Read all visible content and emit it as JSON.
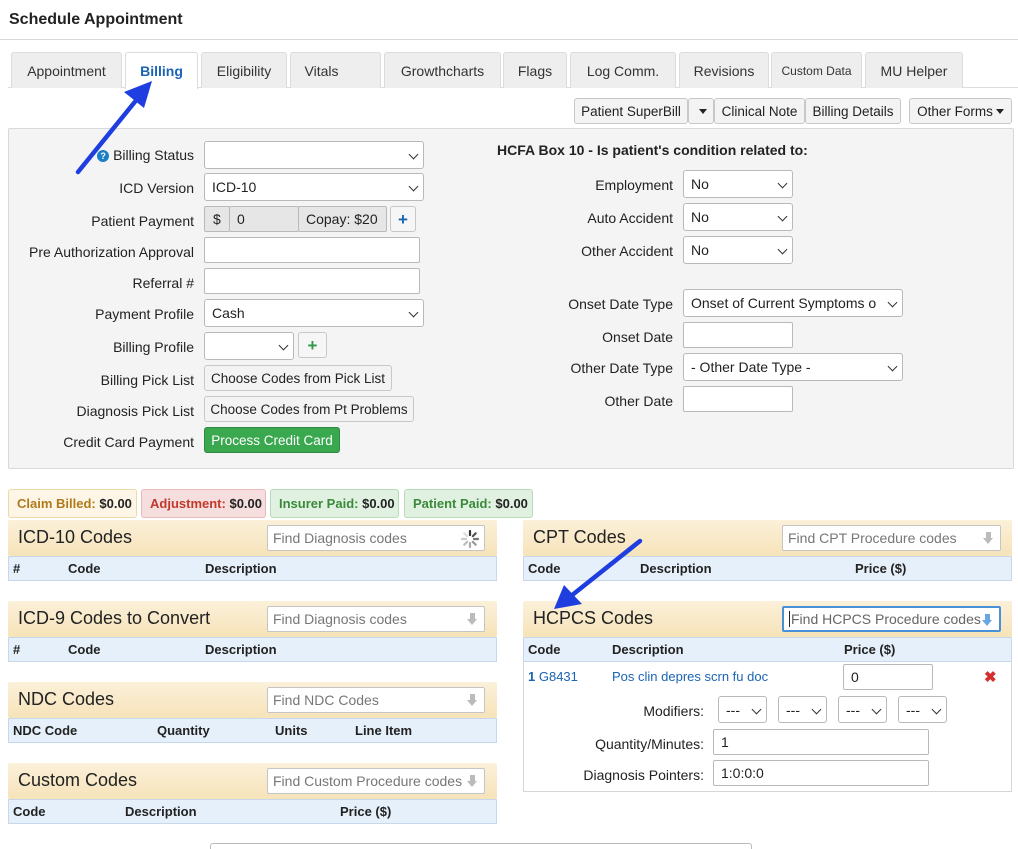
{
  "page": {
    "title": "Schedule Appointment"
  },
  "tabs": [
    {
      "label": "Appointment"
    },
    {
      "label": "Billing"
    },
    {
      "label": "Eligibility"
    },
    {
      "label": "Vitals"
    },
    {
      "label": "Growthcharts"
    },
    {
      "label": "Flags"
    },
    {
      "label": "Log Comm."
    },
    {
      "label": "Revisions"
    },
    {
      "label": "Custom Data"
    },
    {
      "label": "MU Helper"
    }
  ],
  "toolbar": {
    "patient_superbill": "Patient SuperBill",
    "clinical_note": "Clinical Note",
    "billing_details": "Billing Details",
    "other_forms": "Other Forms"
  },
  "billing_form": {
    "billing_status": {
      "label": "Billing Status",
      "value": ""
    },
    "icd_version": {
      "label": "ICD Version",
      "value": "ICD-10"
    },
    "patient_payment": {
      "label": "Patient Payment",
      "currency": "$",
      "value": "0",
      "copay": "Copay: $20"
    },
    "pre_auth": {
      "label": "Pre Authorization Approval",
      "value": ""
    },
    "referral": {
      "label": "Referral #",
      "value": ""
    },
    "payment_profile": {
      "label": "Payment Profile",
      "value": "Cash"
    },
    "billing_profile": {
      "label": "Billing Profile",
      "value": ""
    },
    "billing_pick_list": {
      "label": "Billing Pick List",
      "button": "Choose Codes from Pick List"
    },
    "diagnosis_pick_list": {
      "label": "Diagnosis Pick List",
      "button": "Choose Codes from Pt Problems"
    },
    "credit_card": {
      "label": "Credit Card Payment",
      "button": "Process Credit Card"
    }
  },
  "hcfa": {
    "heading": "HCFA Box 10 - Is patient's condition related to:",
    "employment": {
      "label": "Employment",
      "value": "No"
    },
    "auto_accident": {
      "label": "Auto Accident",
      "value": "No"
    },
    "other_accident": {
      "label": "Other Accident",
      "value": "No"
    },
    "onset_date_type": {
      "label": "Onset Date Type",
      "value": "Onset of Current Symptoms o"
    },
    "onset_date": {
      "label": "Onset Date",
      "value": ""
    },
    "other_date_type": {
      "label": "Other Date Type",
      "value": "- Other Date Type -"
    },
    "other_date": {
      "label": "Other Date",
      "value": ""
    }
  },
  "summary": {
    "claim_billed": {
      "label": "Claim Billed:",
      "value": "$0.00"
    },
    "adjustment": {
      "label": "Adjustment:",
      "value": "$0.00"
    },
    "insurer_paid": {
      "label": "Insurer Paid:",
      "value": "$0.00"
    },
    "patient_paid": {
      "label": "Patient Paid:",
      "value": "$0.00"
    }
  },
  "icd10": {
    "title": "ICD-10 Codes",
    "placeholder": "Find Diagnosis codes",
    "cols": [
      "#",
      "Code",
      "Description"
    ]
  },
  "icd9": {
    "title": "ICD-9 Codes to Convert",
    "placeholder": "Find Diagnosis codes",
    "cols": [
      "#",
      "Code",
      "Description"
    ]
  },
  "ndc": {
    "title": "NDC Codes",
    "placeholder": "Find NDC Codes",
    "cols": [
      "NDC Code",
      "Quantity",
      "Units",
      "Line Item"
    ]
  },
  "custom": {
    "title": "Custom Codes",
    "placeholder": "Find Custom Procedure codes",
    "cols": [
      "Code",
      "Description",
      "Price ($)"
    ]
  },
  "cpt": {
    "title": "CPT Codes",
    "placeholder": "Find CPT Procedure codes",
    "cols": [
      "Code",
      "Description",
      "Price ($)"
    ]
  },
  "hcpcs": {
    "title": "HCPCS Codes",
    "placeholder": "Find HCPCS Procedure codes",
    "cols": [
      "Code",
      "Description",
      "Price ($)"
    ],
    "row": {
      "num": "1",
      "code": "G8431",
      "description": "Pos clin depres scrn fu doc",
      "price": "0"
    },
    "modifiers_label": "Modifiers:",
    "modifier_values": [
      "---",
      "---",
      "---",
      "---"
    ],
    "quantity_label": "Quantity/Minutes:",
    "quantity": "1",
    "diag_label": "Diagnosis Pointers:",
    "diag_value": "1:0:0:0"
  },
  "colors": {
    "accent": "#1a64b4",
    "annotation_arrow": "#1f3ee0",
    "success": "#3aa84f"
  }
}
